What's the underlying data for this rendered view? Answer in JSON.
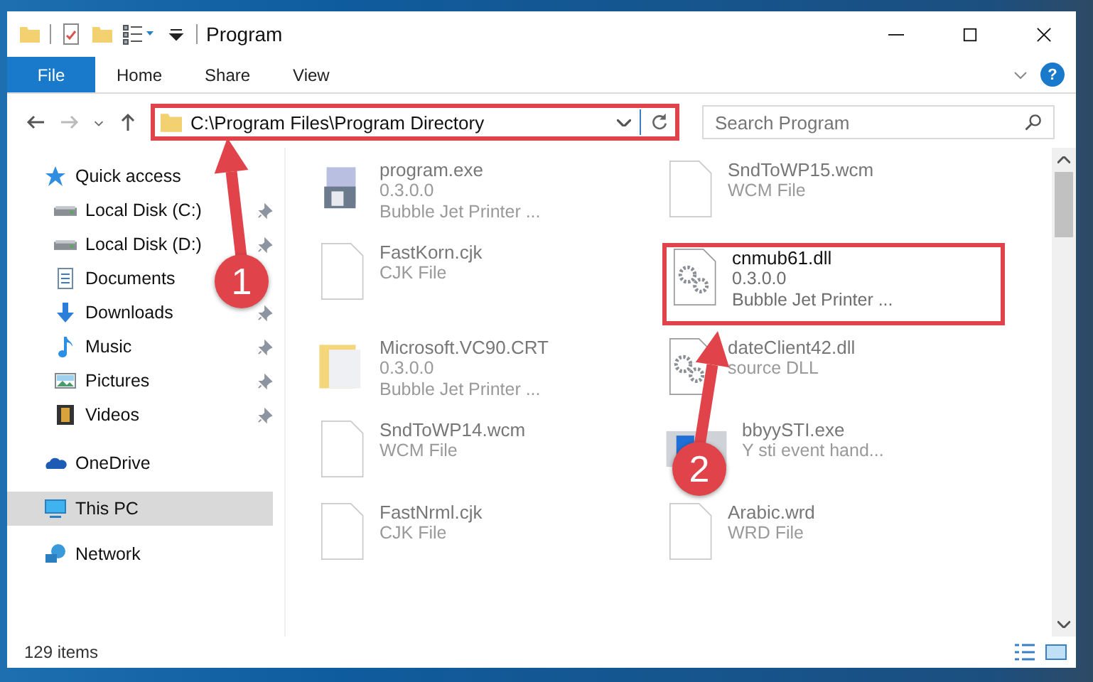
{
  "window": {
    "title": "Program"
  },
  "ribbon_tabs": [
    {
      "label": "File",
      "kind": "file"
    },
    {
      "label": "Home",
      "kind": "tab"
    },
    {
      "label": "Share",
      "kind": "tab"
    },
    {
      "label": "View",
      "kind": "tab"
    }
  ],
  "help_button": "?",
  "address": {
    "value": "C:\\Program Files\\Program Directory",
    "highlighted": true
  },
  "search": {
    "placeholder": "Search Program"
  },
  "nav": [
    {
      "label": "Quick access",
      "kind": "star",
      "selected": false,
      "children": [
        {
          "label": "Local Disk (C:)",
          "kind": "drive",
          "pinned": true,
          "selected": false
        },
        {
          "label": "Local Disk (D:)",
          "kind": "drive",
          "pinned": true,
          "selected": false
        },
        {
          "label": "Documents",
          "kind": "document",
          "pinned": false,
          "selected": false
        },
        {
          "label": "Downloads",
          "kind": "download",
          "pinned": true,
          "selected": false
        },
        {
          "label": "Music",
          "kind": "music",
          "pinned": true,
          "selected": false
        },
        {
          "label": "Pictures",
          "kind": "pictures",
          "pinned": true,
          "selected": false
        },
        {
          "label": "Videos",
          "kind": "videos",
          "pinned": true,
          "selected": false
        }
      ]
    },
    {
      "label": "OneDrive",
      "kind": "cloud",
      "selected": false
    },
    {
      "label": "This PC",
      "kind": "pc",
      "selected": true
    },
    {
      "label": "Network",
      "kind": "network",
      "selected": false
    }
  ],
  "files": [
    {
      "name": "program.exe",
      "details": [
        "0.3.0.0",
        "Bubble Jet Printer ..."
      ],
      "kind": "exe",
      "blurred": true,
      "highlighted": false
    },
    {
      "name": "SndToWP15.wcm",
      "details": [
        "WCM File"
      ],
      "kind": "file",
      "blurred": true,
      "highlighted": false
    },
    {
      "name": "FastKorn.cjk",
      "details": [
        "CJK File"
      ],
      "kind": "file",
      "blurred": true,
      "highlighted": false
    },
    {
      "name": "cnmub61.dll",
      "details": [
        "0.3.0.0",
        "Bubble Jet Printer ..."
      ],
      "kind": "dll",
      "blurred": false,
      "highlighted": true
    },
    {
      "name": "Microsoft.VC90.CRT",
      "details": [
        "0.3.0.0",
        "Bubble Jet Printer ..."
      ],
      "kind": "folder",
      "blurred": true,
      "highlighted": false
    },
    {
      "name": "dateClient42.dll",
      "details": [
        "source DLL"
      ],
      "kind": "dll",
      "blurred": true,
      "highlighted": false
    },
    {
      "name": "SndToWP14.wcm",
      "details": [
        "WCM File"
      ],
      "kind": "file",
      "blurred": true,
      "highlighted": false
    },
    {
      "name": "bbyySTI.exe",
      "details": [
        "Y sti event hand..."
      ],
      "kind": "app",
      "blurred": true,
      "highlighted": false
    },
    {
      "name": "FastNrml.cjk",
      "details": [
        "CJK File"
      ],
      "kind": "file",
      "blurred": true,
      "highlighted": false
    },
    {
      "name": "Arabic.wrd",
      "details": [
        "WRD File"
      ],
      "kind": "file",
      "blurred": true,
      "highlighted": false
    }
  ],
  "status_bar": {
    "item_count": "129 items"
  },
  "callouts": [
    {
      "number": "1"
    },
    {
      "number": "2"
    }
  ]
}
